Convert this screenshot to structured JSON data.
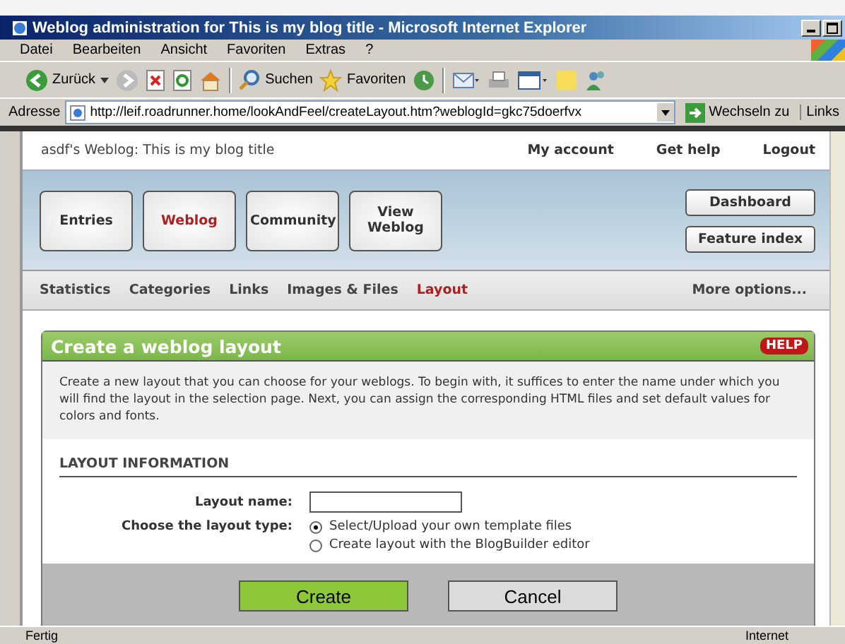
{
  "window": {
    "title": "Weblog administration for This is my blog title - Microsoft Internet Explorer"
  },
  "menu": [
    "Datei",
    "Bearbeiten",
    "Ansicht",
    "Favoriten",
    "Extras",
    "?"
  ],
  "toolbar": {
    "back": "Zurück",
    "search": "Suchen",
    "favorites": "Favoriten"
  },
  "address": {
    "label": "Adresse",
    "url": "http://leif.roadrunner.home/lookAndFeel/createLayout.htm?weblogId=gkc75doerfvx",
    "go": "Wechseln zu",
    "links": "Links"
  },
  "header": {
    "title": "asdf's Weblog: This is my blog title",
    "links": [
      "My account",
      "Get help",
      "Logout"
    ]
  },
  "main_tabs": [
    {
      "label": "Entries",
      "selected": false
    },
    {
      "label": "Weblog",
      "selected": true
    },
    {
      "label": "Community",
      "selected": false
    },
    {
      "label": "View Weblog",
      "selected": false
    }
  ],
  "side_buttons": [
    "Dashboard",
    "Feature index"
  ],
  "subnav": [
    {
      "label": "Statistics",
      "selected": false
    },
    {
      "label": "Categories",
      "selected": false
    },
    {
      "label": "Links",
      "selected": false
    },
    {
      "label": "Images & Files",
      "selected": false
    },
    {
      "label": "Layout",
      "selected": true
    }
  ],
  "more_options": "More options...",
  "card": {
    "title": "Create a weblog layout",
    "help": "HELP",
    "description": "Create a new layout that you can choose for your weblogs. To begin with, it suffices to enter the name under which you will find the layout in the selection page. Next, you can assign the corresponding HTML files and set default values for colors and fonts.",
    "section": "LAYOUT INFORMATION",
    "name_label": "Layout name:",
    "type_label": "Choose the layout type:",
    "options": [
      {
        "label": "Select/Upload your own template files",
        "selected": true
      },
      {
        "label": "Create layout with the BlogBuilder editor",
        "selected": false
      }
    ]
  },
  "buttons": [
    {
      "label": "Create",
      "kind": "primary"
    },
    {
      "label": "Cancel",
      "kind": "secondary"
    }
  ],
  "status_bar": {
    "text": "Fertig",
    "zone": "Internet"
  }
}
